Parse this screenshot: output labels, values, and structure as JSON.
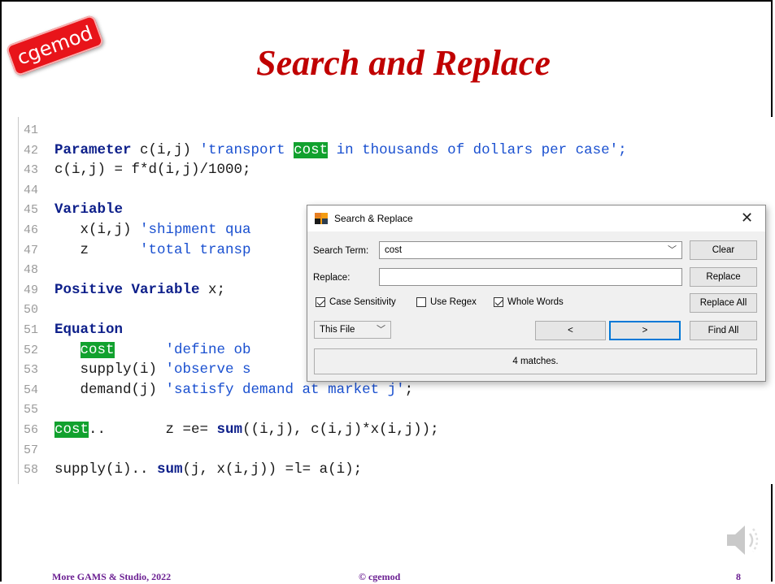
{
  "badge": "cgemod",
  "title": "Search and Replace",
  "editor": {
    "lines": [
      {
        "num": "41",
        "parts": []
      },
      {
        "num": "42",
        "parts": [
          {
            "t": "Parameter",
            "c": "kw"
          },
          {
            "t": " c(i,j) ",
            "c": "txt"
          },
          {
            "t": "'transport ",
            "c": "str"
          },
          {
            "t": "cost",
            "c": "hl"
          },
          {
            "t": " in thousands of dollars per case';",
            "c": "str"
          }
        ]
      },
      {
        "num": "43",
        "parts": [
          {
            "t": "c(i,j) = f*d(i,j)/1000;",
            "c": "txt"
          }
        ]
      },
      {
        "num": "44",
        "parts": []
      },
      {
        "num": "45",
        "parts": [
          {
            "t": "Variable",
            "c": "kw"
          }
        ]
      },
      {
        "num": "46",
        "parts": [
          {
            "t": "   x(i,j) ",
            "c": "txt"
          },
          {
            "t": "'shipment qua",
            "c": "str"
          }
        ]
      },
      {
        "num": "47",
        "parts": [
          {
            "t": "   z      ",
            "c": "txt"
          },
          {
            "t": "'total transp",
            "c": "str"
          }
        ]
      },
      {
        "num": "48",
        "parts": []
      },
      {
        "num": "49",
        "parts": [
          {
            "t": "Positive Variable",
            "c": "kw"
          },
          {
            "t": " x;",
            "c": "txt"
          }
        ]
      },
      {
        "num": "50",
        "parts": []
      },
      {
        "num": "51",
        "parts": [
          {
            "t": "Equation",
            "c": "kw"
          }
        ]
      },
      {
        "num": "52",
        "parts": [
          {
            "t": "   ",
            "c": "txt"
          },
          {
            "t": "cost",
            "c": "hl"
          },
          {
            "t": "      ",
            "c": "txt"
          },
          {
            "t": "'define ob",
            "c": "str"
          }
        ]
      },
      {
        "num": "53",
        "parts": [
          {
            "t": "   supply(i) ",
            "c": "txt"
          },
          {
            "t": "'observe s",
            "c": "str"
          }
        ]
      },
      {
        "num": "54",
        "parts": [
          {
            "t": "   demand(j) ",
            "c": "txt"
          },
          {
            "t": "'satisfy demand at market j'",
            "c": "str"
          },
          {
            "t": ";",
            "c": "txt"
          }
        ]
      },
      {
        "num": "55",
        "parts": []
      },
      {
        "num": "56",
        "parts": [
          {
            "t": "cost",
            "c": "hl"
          },
          {
            "t": "..       z =e= ",
            "c": "txt"
          },
          {
            "t": "sum",
            "c": "kw"
          },
          {
            "t": "((i,j), c(i,j)*x(i,j));",
            "c": "txt"
          }
        ]
      },
      {
        "num": "57",
        "parts": []
      },
      {
        "num": "58",
        "parts": [
          {
            "t": "supply(i).. ",
            "c": "txt"
          },
          {
            "t": "sum",
            "c": "kw"
          },
          {
            "t": "(j, x(i,j)) =l= a(i);",
            "c": "txt"
          }
        ]
      }
    ]
  },
  "dialog": {
    "title": "Search & Replace",
    "search_label": "Search Term:",
    "search_value": "cost",
    "replace_label": "Replace:",
    "replace_value": "",
    "case_sensitivity": {
      "label": "Case Sensitivity",
      "checked": true
    },
    "use_regex": {
      "label": "Use Regex",
      "checked": false
    },
    "whole_words": {
      "label": "Whole Words",
      "checked": true
    },
    "scope": "This File",
    "prev_label": "<",
    "next_label": ">",
    "clear_label": "Clear",
    "replace_btn": "Replace",
    "replace_all_btn": "Replace All",
    "find_all_btn": "Find All",
    "status": "4 matches."
  },
  "footer": {
    "left": "More GAMS & Studio, 2022",
    "center": "© cgemod",
    "page": "8"
  }
}
